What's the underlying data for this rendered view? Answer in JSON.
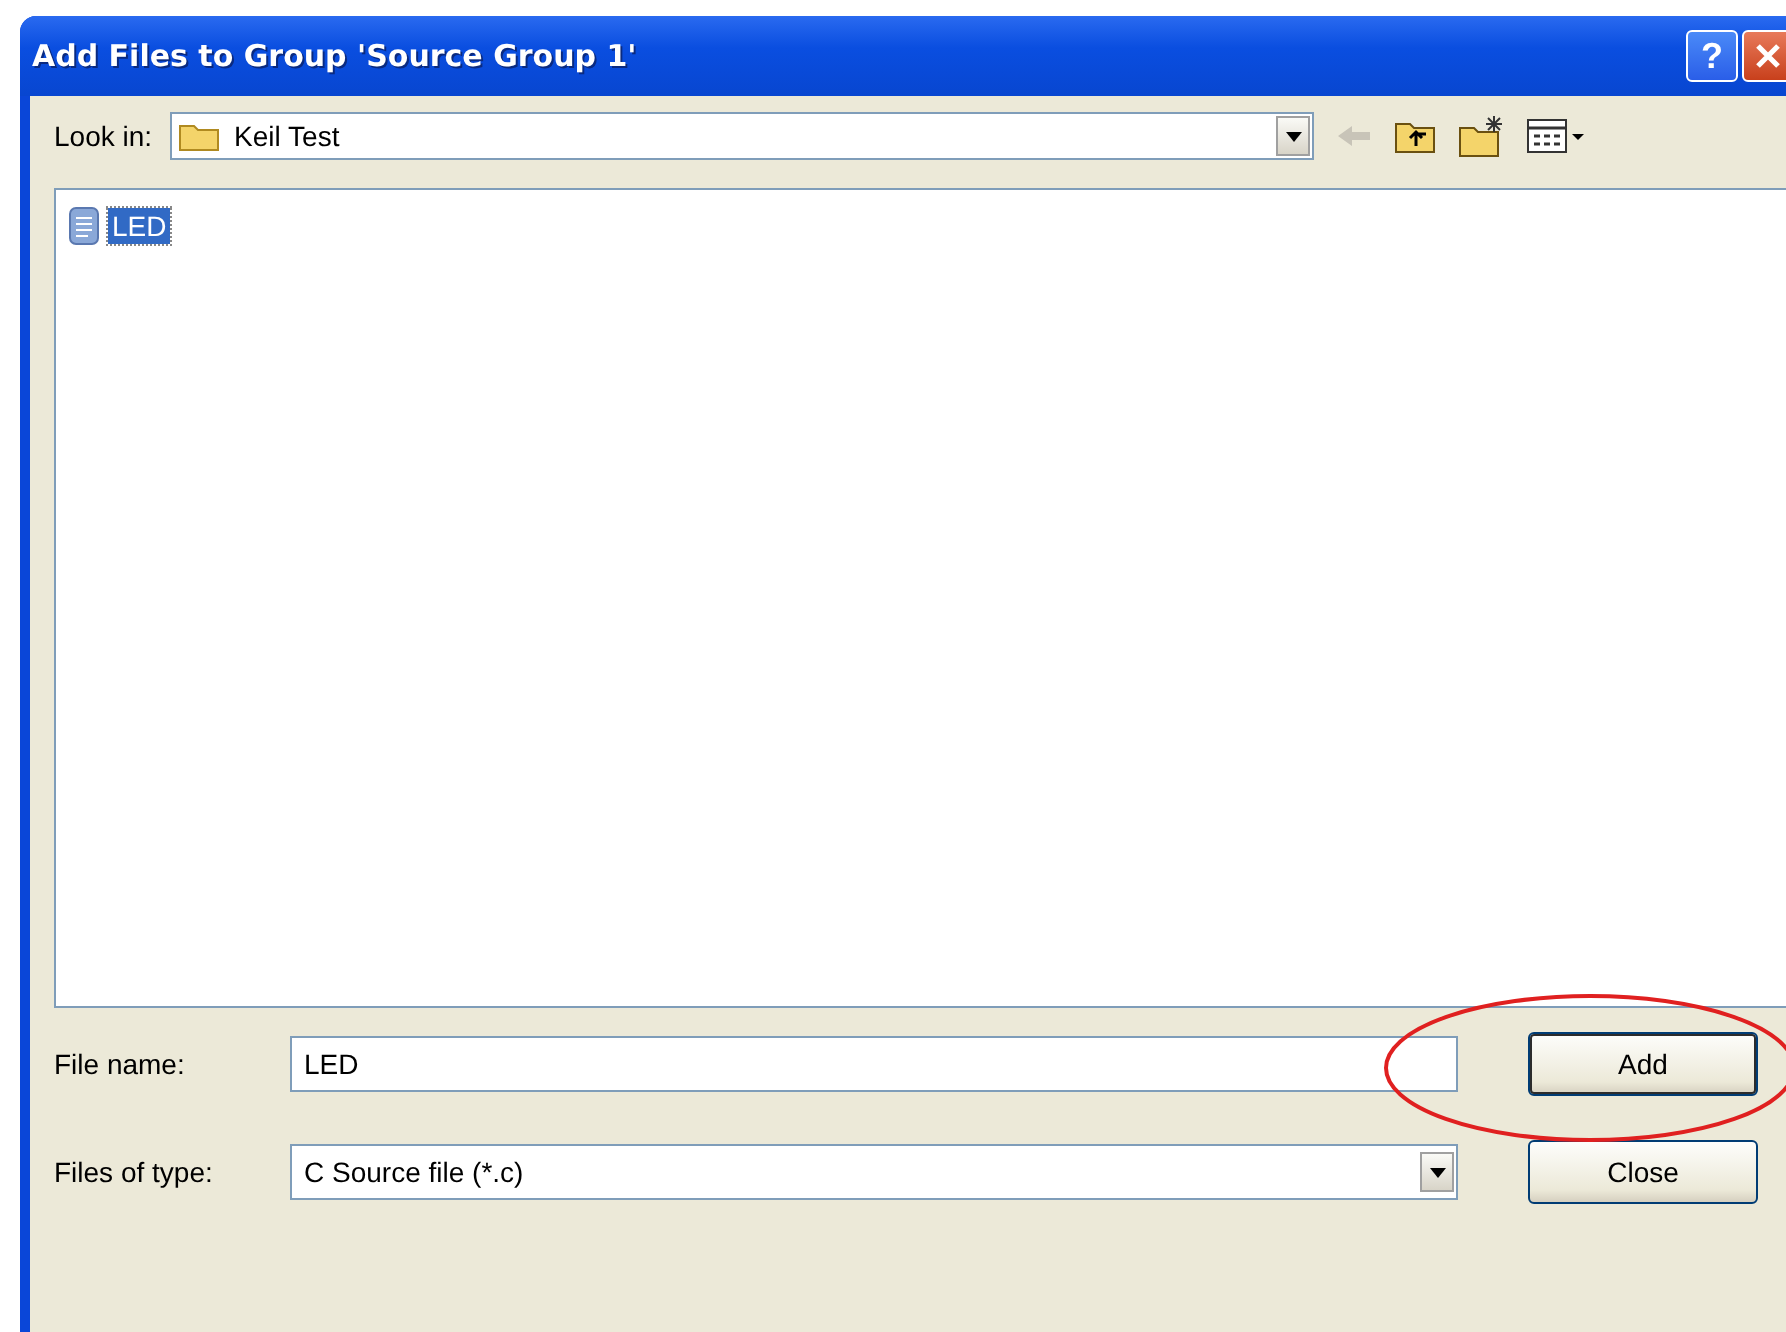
{
  "window": {
    "title": "Add Files to Group 'Source Group 1'",
    "help_button": "?"
  },
  "look_in": {
    "label": "Look in:",
    "value": "Keil Test"
  },
  "files": [
    {
      "name": "LED",
      "selected": true
    }
  ],
  "file_name": {
    "label": "File name:",
    "value": "LED"
  },
  "file_type": {
    "label": "Files of type:",
    "value": "C Source file (*.c)"
  },
  "buttons": [
    {
      "label": "Add",
      "kind": "default"
    },
    {
      "label": "Close",
      "kind": "normal"
    }
  ]
}
